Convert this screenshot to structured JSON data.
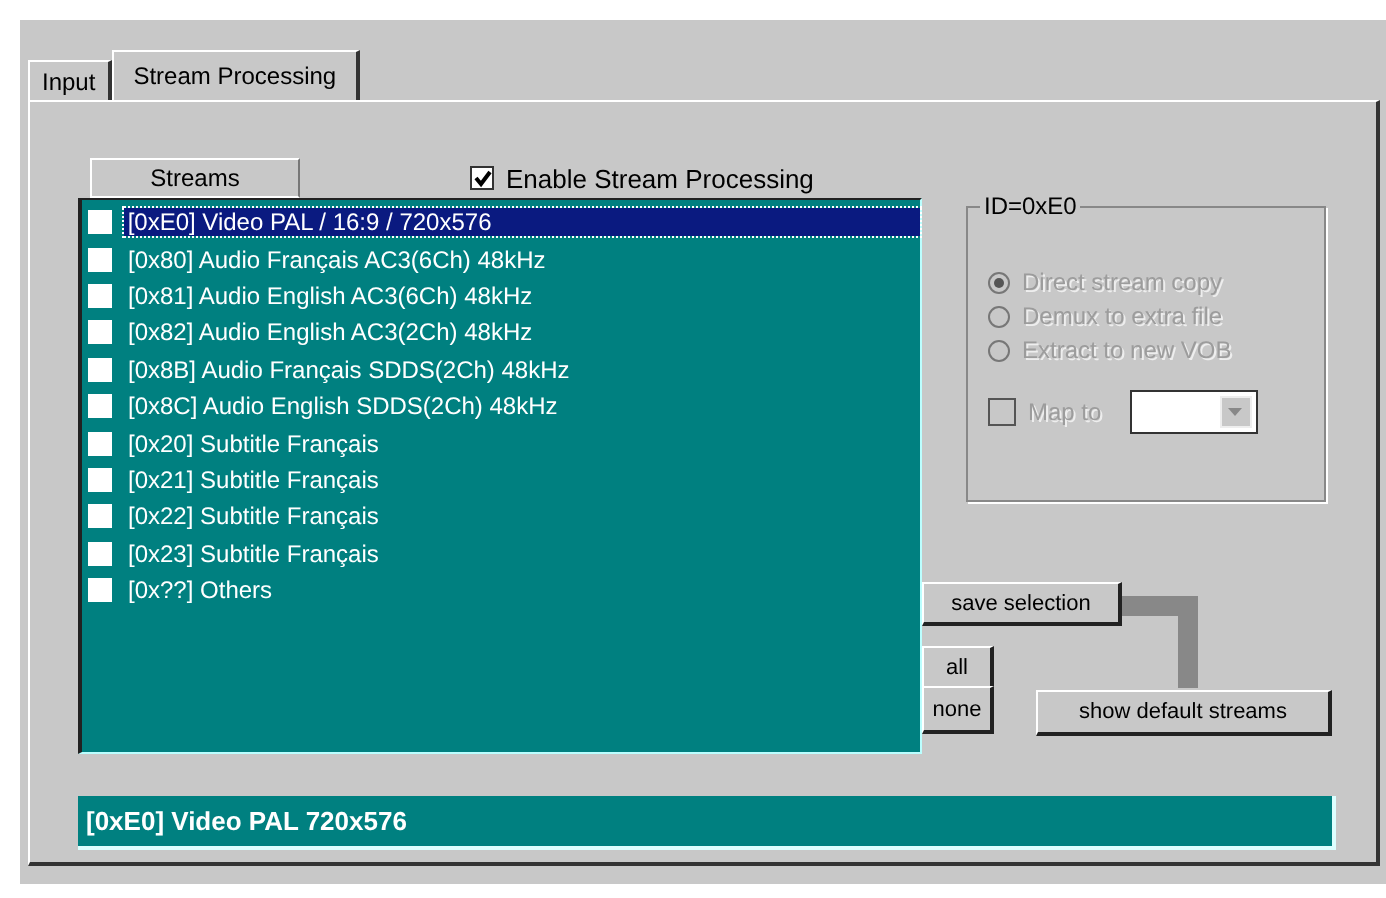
{
  "tabs": [
    {
      "label": "Input",
      "selected": false
    },
    {
      "label": "Stream Processing",
      "selected": true
    }
  ],
  "streams_header": "Streams",
  "enable_processing": {
    "label": "Enable Stream Processing",
    "checked": true
  },
  "streams": [
    {
      "label": "[0xE0] Video PAL / 16:9 / 720x576",
      "checked": false,
      "selected": true
    },
    {
      "label": "[0x80] Audio Français AC3(6Ch) 48kHz",
      "checked": false,
      "selected": false
    },
    {
      "label": "[0x81] Audio English AC3(6Ch) 48kHz",
      "checked": false,
      "selected": false
    },
    {
      "label": "[0x82] Audio English AC3(2Ch) 48kHz",
      "checked": false,
      "selected": false
    },
    {
      "label": "[0x8B] Audio Français SDDS(2Ch) 48kHz",
      "checked": false,
      "selected": false
    },
    {
      "label": "[0x8C] Audio English SDDS(2Ch) 48kHz",
      "checked": false,
      "selected": false
    },
    {
      "label": "[0x20] Subtitle Français",
      "checked": false,
      "selected": false
    },
    {
      "label": "[0x21] Subtitle Français",
      "checked": false,
      "selected": false
    },
    {
      "label": "[0x22] Subtitle Français",
      "checked": false,
      "selected": false
    },
    {
      "label": "[0x23] Subtitle Français",
      "checked": false,
      "selected": false
    },
    {
      "label": "[0x??] Others",
      "checked": false,
      "selected": false
    }
  ],
  "group": {
    "title": "ID=0xE0",
    "disabled": true,
    "options": [
      {
        "label": "Direct stream copy",
        "selected": true
      },
      {
        "label": "Demux to extra file",
        "selected": false
      },
      {
        "label": "Extract to new VOB",
        "selected": false
      }
    ],
    "map_to": {
      "label": "Map to",
      "checked": false
    }
  },
  "buttons": {
    "save": "save selection",
    "all": "all",
    "none": "none",
    "defaults": "show default streams"
  },
  "status": "[0xE0] Video PAL 720x576"
}
